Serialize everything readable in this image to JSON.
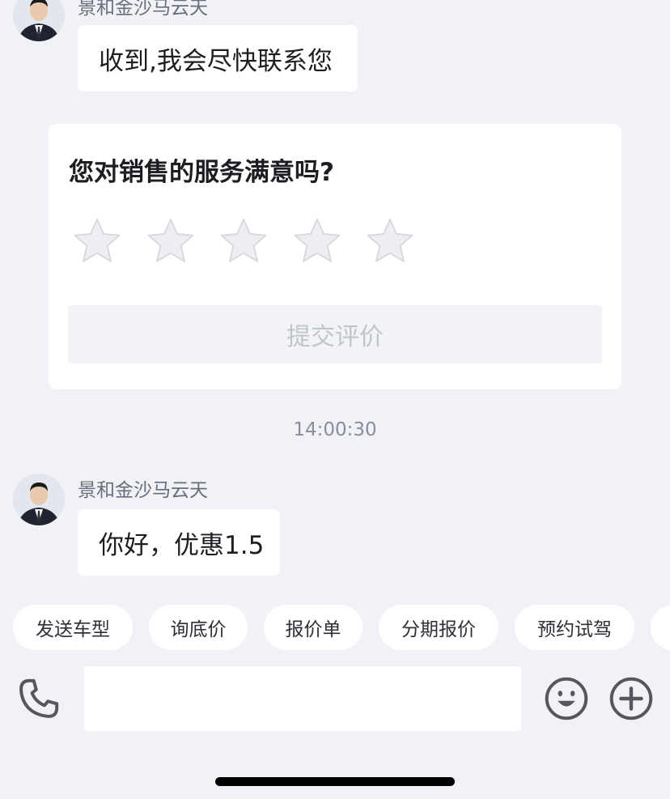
{
  "messages": [
    {
      "sender": "景和金沙马云天",
      "text": "收到,我会尽快联系您"
    },
    {
      "sender": "景和金沙马云天",
      "text": "你好，优惠1.5"
    }
  ],
  "rating": {
    "question": "您对销售的服务满意吗?",
    "stars_total": 5,
    "stars_selected": 0,
    "submit_label": "提交评价"
  },
  "timestamp": "14:00:30",
  "quick_replies": [
    "发送车型",
    "询底价",
    "报价单",
    "分期报价",
    "预约试驾"
  ],
  "input": {
    "value": "",
    "placeholder": ""
  },
  "icons": {
    "call": "phone-icon",
    "emoji": "smile-icon",
    "more": "plus-circle-icon"
  },
  "colors": {
    "background": "#f1f2f7",
    "bubble": "#ffffff",
    "star_empty": "#eeeef2",
    "icon": "#55565e",
    "submit_disabled_text": "#c2c4cc"
  }
}
